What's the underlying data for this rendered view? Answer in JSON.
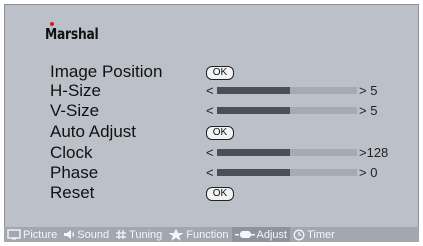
{
  "brand": "Marshal",
  "menu": {
    "image_position": {
      "label": "Image Position",
      "button": "OK"
    },
    "h_size": {
      "label": "H-Size",
      "left": "<",
      "right": "> 5",
      "level": 0.52
    },
    "v_size": {
      "label": "V-Size",
      "left": "<",
      "right": "> 5",
      "level": 0.52
    },
    "auto_adjust": {
      "label": "Auto Adjust",
      "button": "OK"
    },
    "clock": {
      "label": "Clock",
      "left": "<",
      "right": ">128",
      "level": 0.52
    },
    "phase": {
      "label": "Phase",
      "left": "<",
      "right": "> 0",
      "level": 0.52
    },
    "reset": {
      "label": "Reset",
      "button": "OK"
    }
  },
  "tabs": [
    {
      "label": "Picture",
      "icon": "monitor-icon",
      "active": false
    },
    {
      "label": "Sound",
      "icon": "speaker-icon",
      "active": false
    },
    {
      "label": "Tuning",
      "icon": "grid-icon",
      "active": false
    },
    {
      "label": "Function",
      "icon": "star-icon",
      "active": false
    },
    {
      "label": "Adjust",
      "icon": "adjust-icon",
      "active": true
    },
    {
      "label": "Timer",
      "icon": "clock-icon",
      "active": false
    }
  ],
  "colors": {
    "osd_bg": "#bcc1c9",
    "bar_fill": "#4a4f58",
    "bar_track": "#a6aab1",
    "logo_accent": "#d41b1b"
  }
}
